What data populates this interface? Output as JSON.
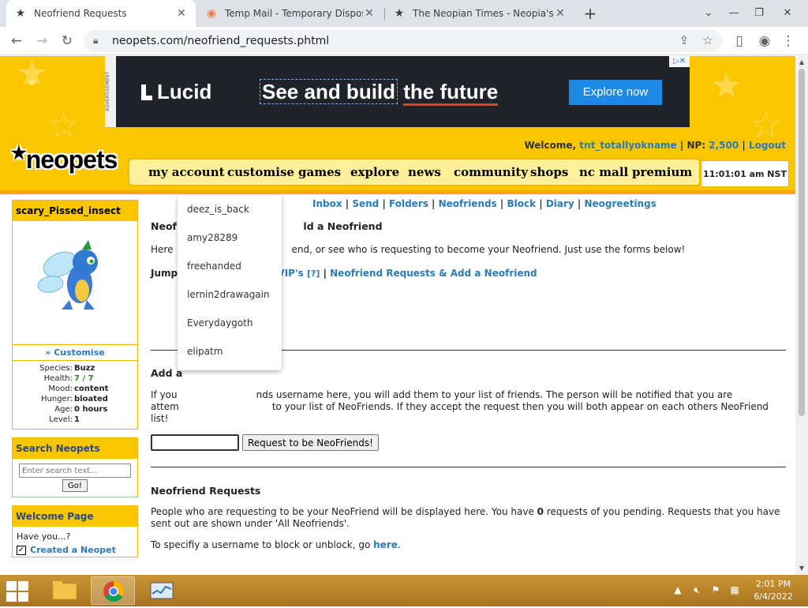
{
  "browser": {
    "tabs": [
      {
        "title": "Neofriend Requests",
        "active": true
      },
      {
        "title": "Temp Mail - Temporary Disposab",
        "active": false
      },
      {
        "title": "The Neopian Times - Neopia's fil",
        "active": false
      }
    ],
    "url": "neopets.com/neofriend_requests.phtml"
  },
  "ad": {
    "label": "ADVERTISEMENT",
    "brand": "Lucid",
    "headline_part1": "See and build",
    "headline_part2": "the future",
    "cta": "Explore now"
  },
  "header": {
    "welcome_label": "Welcome,",
    "username": "tnt_totallyokname",
    "np_label": "NP:",
    "np_value": "2,500",
    "logout": "Logout",
    "logo": "neopets",
    "nav": [
      "my account",
      "customise",
      "games",
      "explore",
      "news",
      "community",
      "shops",
      "nc mall",
      "premium"
    ],
    "time": "11:01:01 am NST"
  },
  "pet": {
    "name": "scary_Pissed_insect",
    "customise": "» Customise",
    "stats": [
      {
        "k": "Species:",
        "v": "Buzz"
      },
      {
        "k": "Health:",
        "v": "7 / 7"
      },
      {
        "k": "Mood:",
        "v": "content"
      },
      {
        "k": "Hunger:",
        "v": "bloated"
      },
      {
        "k": "Age:",
        "v": "0 hours"
      },
      {
        "k": "Level:",
        "v": "1"
      }
    ]
  },
  "search": {
    "title": "Search Neopets",
    "placeholder": "Enter search text...",
    "go": "Go!"
  },
  "welcome_page": {
    "title": "Welcome Page",
    "text": "Have you...?",
    "item": "Created a Neopet"
  },
  "subnav": [
    "Inbox",
    "Send",
    "Folders",
    "Neofriends",
    "Block",
    "Diary",
    "Neogreetings"
  ],
  "main": {
    "heading_left": "Neofri",
    "heading_right": "ld a Neofriend",
    "intro_left": "Here",
    "intro_right": "end, or see who is requesting to become your Neofriend. Just use the forms below!",
    "jump_left": "Jump",
    "jump_vips": "l VIP's",
    "jump_help": "[?]",
    "jump_requests": "Neofriend Requests & Add a Neofriend",
    "add_heading": "Add a",
    "add_text_l1a": "If you",
    "add_text_l1b": "nds username here, you will add them to your list of friends. The person will be notified that you are",
    "add_text_l2a": "attem",
    "add_text_l2b": "to your list of NeoFriends. If they accept the request then you will both appear on each others NeoFriend",
    "add_text_l3": "list!",
    "request_button": "Request to be NeoFriends!",
    "requests_heading": "Neofriend Requests",
    "requests_text_a": "People who are requesting to be your NeoFriend will be displayed here. You have ",
    "requests_count": "0",
    "requests_text_b": " requests of you pending. Requests that you have",
    "requests_text_c": "sent out are shown under 'All Neofriends'.",
    "block_text": "To specifiy a username to block or unblock, go ",
    "block_link": "here",
    "block_end": "."
  },
  "autocomplete": [
    "deez_is_back",
    "amy28289",
    "freehanded",
    "lernin2drawagain",
    "Everydaygoth",
    "elipatm"
  ],
  "taskbar": {
    "time": "2:01 PM",
    "date": "6/4/2022"
  }
}
